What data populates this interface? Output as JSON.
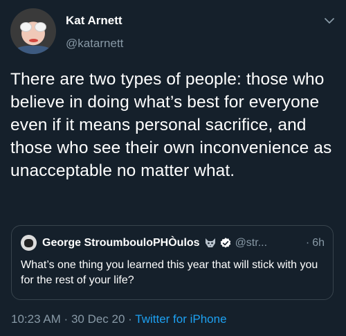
{
  "author": {
    "display_name": "Kat Arnett",
    "handle": "@katarnett"
  },
  "tweet": {
    "text": "There are two types of people: those who believe in doing what’s best for everyone even if it means personal sacrifice, and those who see their own inconvenience as unacceptable no matter what."
  },
  "quoted_tweet": {
    "display_name": "George StroumbouloPHÒulos",
    "handle": "@str...",
    "separator": "·",
    "time": "6h",
    "text": "What’s one thing you learned this year that will stick with you for the rest of your life?"
  },
  "meta": {
    "time": "10:23 AM",
    "sep1": " · ",
    "date": "30 Dec 20",
    "sep2": " · ",
    "source": "Twitter for iPhone"
  },
  "colors": {
    "background": "#15202b",
    "muted": "#8899a6",
    "link": "#1da1f2",
    "border": "#38444d"
  },
  "icons": {
    "menu": "chevron-down-icon",
    "verified": "verified-badge-icon",
    "name_emoji": "wolf-emoji-icon"
  }
}
